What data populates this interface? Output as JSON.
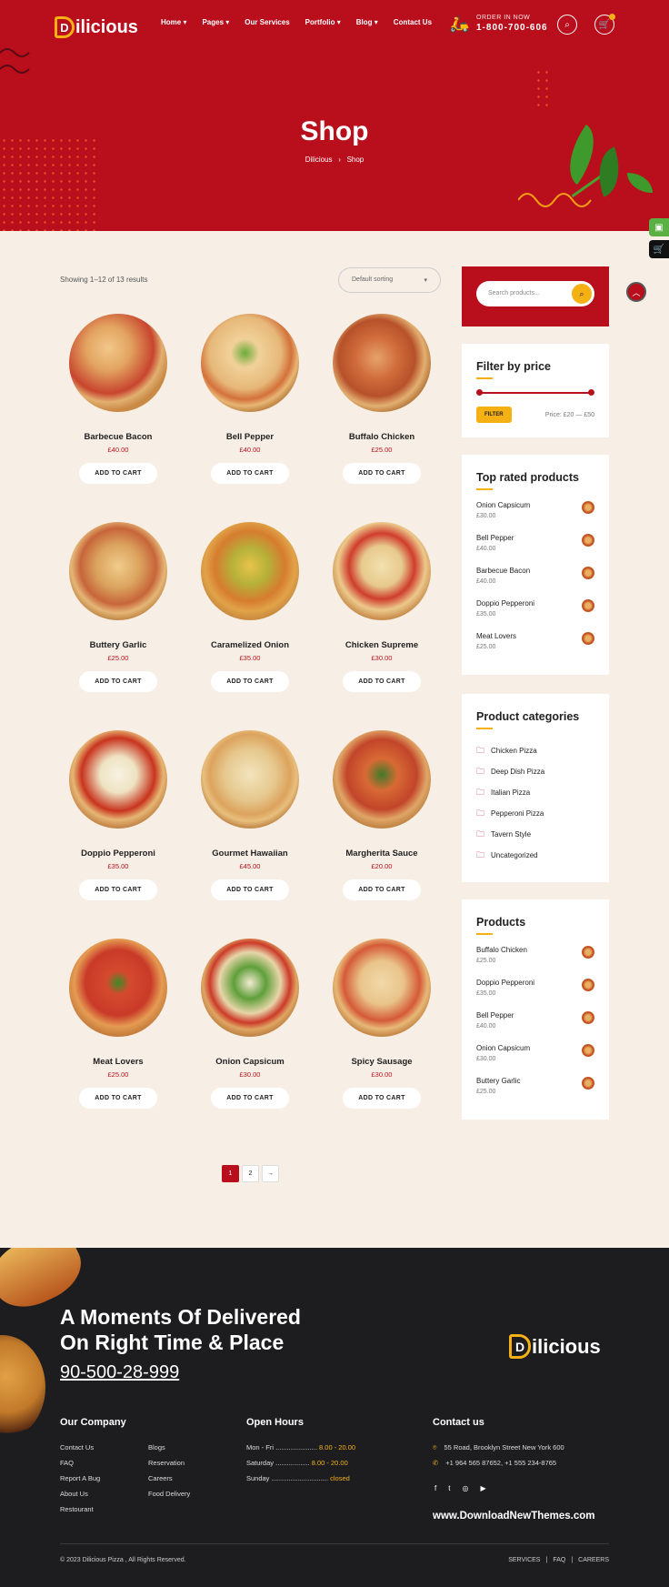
{
  "header": {
    "logo_rest": "ilicious",
    "logo_letter": "D",
    "nav": [
      "Home ▾",
      "Pages ▾",
      "Our Services",
      "Portfolio ▾",
      "Blog ▾",
      "Contact Us"
    ],
    "order_label": "ORDER IN NOW",
    "order_phone": "1-800-700-606"
  },
  "hero": {
    "title": "Shop",
    "crumb_home": "Dilicious",
    "crumb_sep": "›",
    "crumb_current": "Shop"
  },
  "shop": {
    "showing": "Showing 1–12 of 13 results",
    "sort": "Default sorting"
  },
  "products": [
    {
      "name": "Barbecue Bacon",
      "price": "£40.00",
      "cart": "ADD TO CART"
    },
    {
      "name": "Bell Pepper",
      "price": "£40.00",
      "cart": "ADD TO CART"
    },
    {
      "name": "Buffalo Chicken",
      "price": "£25.00",
      "cart": "ADD TO CART"
    },
    {
      "name": "Buttery Garlic",
      "price": "£25.00",
      "cart": "ADD TO CART"
    },
    {
      "name": "Caramelized Onion",
      "price": "£35.00",
      "cart": "ADD TO CART"
    },
    {
      "name": "Chicken Supreme",
      "price": "£30.00",
      "cart": "ADD TO CART"
    },
    {
      "name": "Doppio Pepperoni",
      "price": "£35.00",
      "cart": "ADD TO CART"
    },
    {
      "name": "Gourmet Hawaiian",
      "price": "£45.00",
      "cart": "ADD TO CART"
    },
    {
      "name": "Margherita Sauce",
      "price": "£20.00",
      "cart": "ADD TO CART"
    },
    {
      "name": "Meat Lovers",
      "price": "£25.00",
      "cart": "ADD TO CART"
    },
    {
      "name": "Onion Capsicum",
      "price": "£30.00",
      "cart": "ADD TO CART"
    },
    {
      "name": "Spicy Sausage",
      "price": "£30.00",
      "cart": "ADD TO CART"
    }
  ],
  "pagination": [
    "1",
    "2",
    "→"
  ],
  "sidebar": {
    "search_placeholder": "Search products...",
    "price_title": "Filter by price",
    "filter_btn": "FILTER",
    "price_range": "Price: £20 — £50",
    "top_title": "Top rated products",
    "top": [
      {
        "n": "Onion Capsicum",
        "p": "£30.00"
      },
      {
        "n": "Bell Pepper",
        "p": "£40.00"
      },
      {
        "n": "Barbecue Bacon",
        "p": "£40.00"
      },
      {
        "n": "Doppio Pepperoni",
        "p": "£35.00"
      },
      {
        "n": "Meat Lovers",
        "p": "£25.00"
      }
    ],
    "cat_title": "Product categories",
    "cats": [
      "Chicken Pizza",
      "Deep Dish Pizza",
      "Italian Pizza",
      "Pepperoni Pizza",
      "Tavern Style",
      "Uncategorized"
    ],
    "prod_title": "Products",
    "prods": [
      {
        "n": "Buffalo Chicken",
        "p": "£25.00"
      },
      {
        "n": "Doppio Pepperoni",
        "p": "£35.00"
      },
      {
        "n": "Bell Pepper",
        "p": "£40.00"
      },
      {
        "n": "Onion Capsicum",
        "p": "£30.00"
      },
      {
        "n": "Buttery Garlic",
        "p": "£25.00"
      }
    ]
  },
  "footer": {
    "headline1": "A Moments Of Delivered",
    "headline2": "On Right Time & Place",
    "phone": "90-500-28-999",
    "company_title": "Our Company",
    "links1": [
      "Contact Us",
      "FAQ",
      "Report A Bug",
      "About Us",
      "Restourant"
    ],
    "links2": [
      "Blogs",
      "Reservation",
      "Careers",
      "Food Delivery"
    ],
    "hours_title": "Open Hours",
    "hours": [
      {
        "d": "Mon - Fri",
        "dots": " ......................",
        "t": "8.00 - 20.00"
      },
      {
        "d": "Saturday",
        "dots": " ..................",
        "t": "8.00 - 20.00"
      },
      {
        "d": "Sunday",
        "dots": " ..............................",
        "t": "closed"
      }
    ],
    "contact_title": "Contact us",
    "address": "55 Road, Brooklyn Street New York 600",
    "phones": "+1 964 565 87652, +1 555 234-8765",
    "social": [
      "f",
      "t",
      "◎",
      "▶"
    ],
    "website": "www.DownloadNewThemes.com",
    "copyright": "© 2023 Dilicious Pizza , All Rights Reserved.",
    "bottom_nav": [
      "SERVICES",
      "|",
      "FAQ",
      "|",
      "CAREERS"
    ]
  }
}
